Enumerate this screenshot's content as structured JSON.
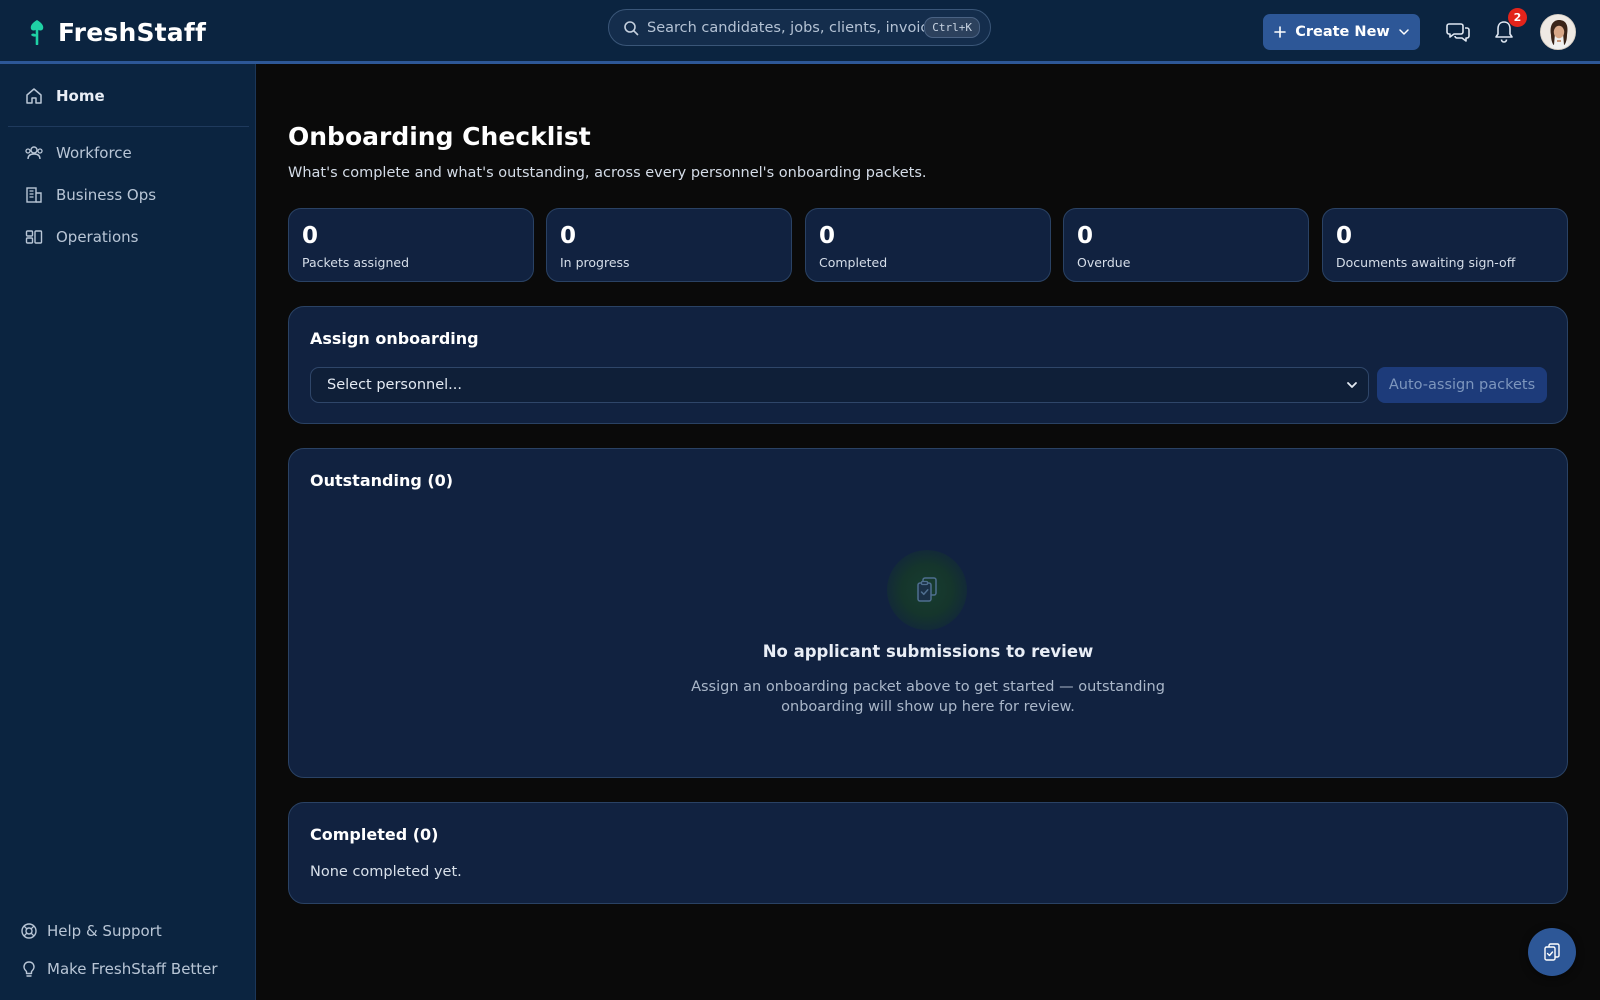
{
  "app": {
    "name": "FreshStaff"
  },
  "header": {
    "search_placeholder": "Search candidates, jobs, clients, invoices...",
    "search_shortcut": "Ctrl+K",
    "create_label": "Create New",
    "notification_count": "2"
  },
  "sidebar": {
    "items": [
      {
        "label": "Home",
        "icon": "home-icon"
      },
      {
        "label": "Workforce",
        "icon": "users-icon"
      },
      {
        "label": "Business Ops",
        "icon": "building-icon"
      },
      {
        "label": "Operations",
        "icon": "dashboard-icon"
      }
    ],
    "footer": [
      {
        "label": "Help & Support",
        "icon": "lifebuoy-icon"
      },
      {
        "label": "Make FreshStaff Better",
        "icon": "lightbulb-icon"
      }
    ]
  },
  "main": {
    "title": "Onboarding Checklist",
    "subtitle": "What's complete and what's outstanding, across every personnel's onboarding packets.",
    "stats": [
      {
        "value": "0",
        "label": "Packets assigned"
      },
      {
        "value": "0",
        "label": "In progress"
      },
      {
        "value": "0",
        "label": "Completed"
      },
      {
        "value": "0",
        "label": "Overdue"
      },
      {
        "value": "0",
        "label": "Documents awaiting sign-off"
      }
    ],
    "assign": {
      "title": "Assign onboarding",
      "select_placeholder": "Select personnel...",
      "auto_assign_label": "Auto-assign packets"
    },
    "outstanding": {
      "title": "Outstanding (0)",
      "empty_title": "No applicant submissions to review",
      "empty_description": "Assign an onboarding packet above to get started — outstanding onboarding will show up here for review."
    },
    "completed": {
      "title": "Completed (0)",
      "empty_text": "None completed yet."
    }
  },
  "colors": {
    "topbar_bg": "#0b2440",
    "page_bg": "#0a0a0a",
    "card_bg": "#112240",
    "accent": "#2d5797",
    "brand_green": "#1fd1a5",
    "badge": "#e3241b"
  }
}
